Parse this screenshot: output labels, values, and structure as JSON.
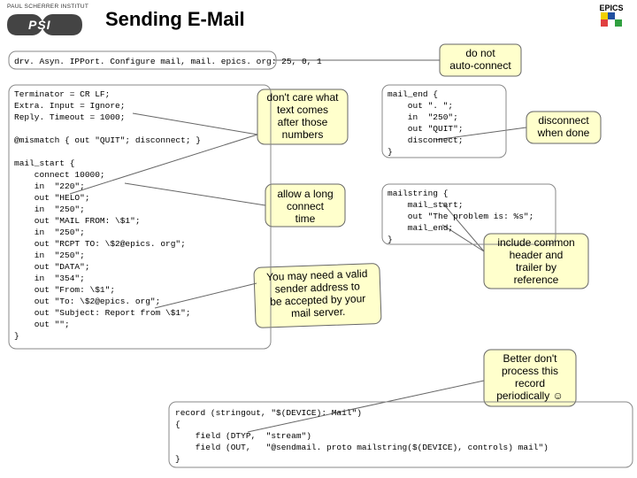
{
  "header": {
    "logo_top": "PAUL SCHERRER INSTITUT",
    "logo_psi": "PSI",
    "title": "Sending E-Mail",
    "epics": "EPICS"
  },
  "code": {
    "drv": "drv. Asyn. IPPort. Configure mail, mail. epics. org: 25, 0, 1",
    "block_top": "Terminator = CR LF;\nExtra. Input = Ignore;\nReply. Timeout = 1000;\n\n@mismatch { out \"QUIT\"; disconnect; }\n\nmail_start {\n    connect 10000;\n    in  \"220\";\n    out \"HELO\";\n    in  \"250\";\n    out \"MAIL FROM: \\$1\";\n    in  \"250\";\n    out \"RCPT TO: \\$2@epics. org\";\n    in  \"250\";\n    out \"DATA\";\n    in  \"354\";\n    out \"From: \\$1\";\n    out \"To: \\$2@epics. org\";\n    out \"Subject: Report from \\$1\";\n    out \"\";\n}",
    "mail_end": "mail_end {\n    out \". \";\n    in  \"250\";\n    out \"QUIT\";\n    disconnect;\n}",
    "mailstring": "mailstring {\n    mail_start;\n    out \"The problem is: %s\";\n    mail_end;\n}",
    "record": "record (stringout, \"$(DEVICE): Mail\")\n{\n    field (DTYP,  \"stream\")\n    field (OUT,   \"@sendmail. proto mailstring($(DEVICE), controls) mail\")\n}"
  },
  "callouts": {
    "c1": "do not\nauto-connect",
    "c2": "don't care what\ntext comes\nafter those\nnumbers",
    "c3": "allow a long\nconnect\ntime",
    "c4": "You may need a valid\nsender address to\nbe accepted by your\nmail server.",
    "c5": "disconnect\nwhen done",
    "c6": "include common\nheader and\ntrailer by\nreference",
    "c7": "Better don't\nprocess this\nrecord\nperiodically ☺"
  }
}
